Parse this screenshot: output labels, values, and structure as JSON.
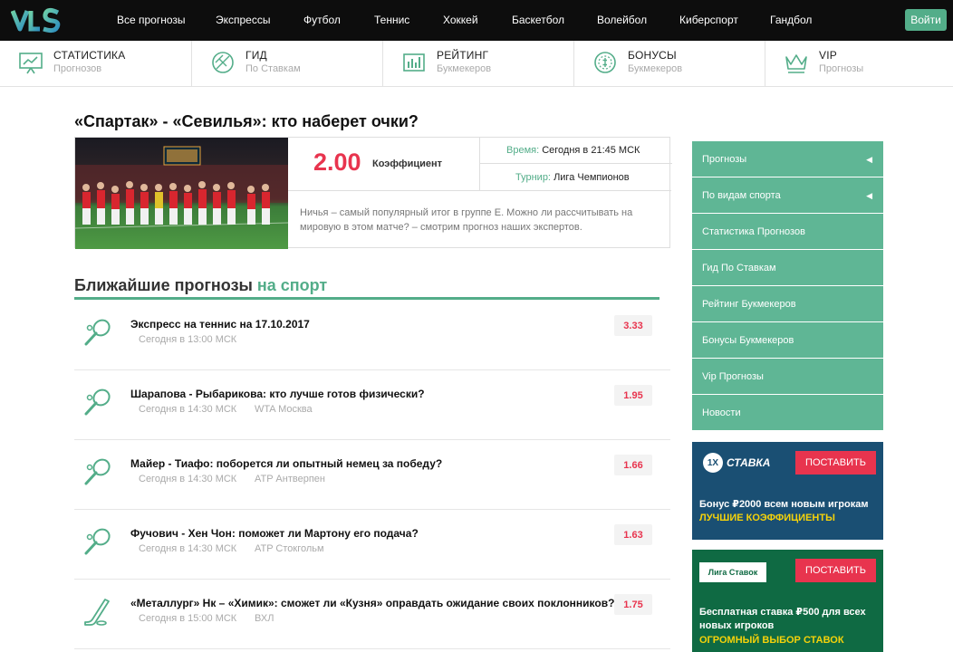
{
  "nav": {
    "items": [
      "Все прогнозы",
      "Экспрессы",
      "Футбол",
      "Теннис",
      "Хоккей",
      "Баскетбол",
      "Волейбол",
      "Киберспорт",
      "Гандбол"
    ],
    "login": "Войти"
  },
  "features": [
    {
      "title": "СТАТИСТИКА",
      "sub": "Прогнозов",
      "icon": "chart-board-icon"
    },
    {
      "title": "ГИД",
      "sub": "По Ставкам",
      "icon": "ball-icon"
    },
    {
      "title": "РЕЙТИНГ",
      "sub": "Букмекеров",
      "icon": "bar-chart-icon"
    },
    {
      "title": "БОНУСЫ",
      "sub": "Букмекеров",
      "icon": "coin-icon"
    },
    {
      "title": "VIP",
      "sub": "Прогнозы",
      "icon": "crown-icon"
    }
  ],
  "main": {
    "title": "«Спартак» - «Севилья»: кто наберет очки?",
    "odds": "2.00",
    "odds_caption": "Коэффициент",
    "time_label": "Время:",
    "time_value": "Сегодня в 21:45 МСК",
    "tournament_label": "Турнир:",
    "tournament_value": "Лига Чемпионов",
    "description": "Ничья – самый популярный итог в группе Е. Можно ли рассчитывать на мировую в этом матче? – смотрим прогноз наших экспертов."
  },
  "section": {
    "title": "Ближайшие прогнозы",
    "accent": "на спорт"
  },
  "forecasts": [
    {
      "title": "Экспресс на теннис на 17.10.2017",
      "time": "Сегодня в 13:00 МСК",
      "venue": "",
      "odds": "3.33",
      "icon": "tennis-racket-icon"
    },
    {
      "title": "Шарапова - Рыбарикова: кто лучше готов физически?",
      "time": "Сегодня в 14:30 МСК",
      "venue": "WTA Москва",
      "odds": "1.95",
      "icon": "tennis-racket-icon"
    },
    {
      "title": "Майер - Тиафо: поборется ли опытный немец за победу?",
      "time": "Сегодня в 14:30 МСК",
      "venue": "ATP Антверпен",
      "odds": "1.66",
      "icon": "tennis-racket-icon"
    },
    {
      "title": "Фучович - Хен Чон: поможет ли Мартону его подача?",
      "time": "Сегодня в 14:30 МСК",
      "venue": "ATP Стокгольм",
      "odds": "1.63",
      "icon": "tennis-racket-icon"
    },
    {
      "title": "«Металлург» Нк – «Химик»: сможет ли «Кузня» оправдать ожидание своих поклонников?",
      "time": "Сегодня в 15:00 МСК",
      "venue": "ВХЛ",
      "odds": "1.75",
      "icon": "hockey-stick-icon"
    }
  ],
  "sidebar": {
    "items": [
      {
        "label": "Прогнозы",
        "arrow": "◀"
      },
      {
        "label": "По видам спорта",
        "arrow": "◀"
      },
      {
        "label": "Статистика Прогнозов",
        "arrow": ""
      },
      {
        "label": "Гид По Ставкам",
        "arrow": ""
      },
      {
        "label": "Рейтинг Букмекеров",
        "arrow": ""
      },
      {
        "label": "Бонусы Букмекеров",
        "arrow": ""
      },
      {
        "label": "Vip Прогнозы",
        "arrow": ""
      },
      {
        "label": "Новости",
        "arrow": ""
      }
    ]
  },
  "ads": [
    {
      "brand_num": "1X",
      "brand": "СТАВКА",
      "cta": "ПОСТАВИТЬ",
      "text": "Бонус ₽2000 всем новым игрокам",
      "accent": "ЛУЧШИЕ КОЭФФИЦИЕНТЫ"
    },
    {
      "brand": "Лига Ставок",
      "cta": "ПОСТАВИТЬ",
      "text": "Бесплатная ставка ₽500 для всех новых игроков",
      "accent": "ОГРОМНЫЙ ВЫБОР СТАВОК"
    }
  ],
  "colors": {
    "accent_green": "#53ad89",
    "odds_red": "#e8344e",
    "nav_bg": "#0d0d0d"
  }
}
